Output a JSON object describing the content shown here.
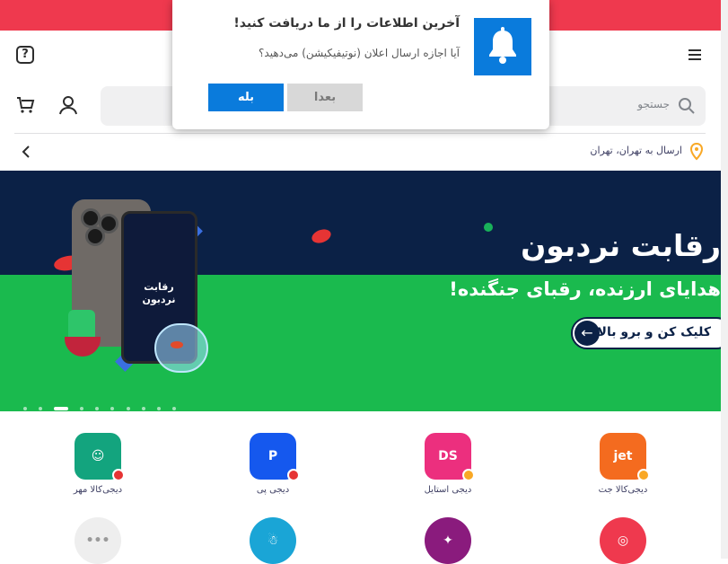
{
  "notification": {
    "title": "آخرین اطلاعات را از ما دریافت کنید!",
    "body": "آیا اجازه ارسال اعلان (نوتیفیکیشن) می‌دهید؟",
    "yes_label": "بله",
    "later_label": "بعدا",
    "icon": "bell-icon"
  },
  "header": {
    "help_icon": "question-icon",
    "menu_icon": "hamburger-icon",
    "cart_icon": "cart-icon",
    "user_icon": "user-icon"
  },
  "search": {
    "placeholder": "جستجو"
  },
  "location": {
    "text": "ارسال به تهران، تهران"
  },
  "banner": {
    "title": "رقابت نردبون",
    "subtitle": "هدایای ارزنده، رقبای جنگنده!",
    "cta": "کلیک کن و برو بالا",
    "phone_label": "رقابت نردبون",
    "slide_count": 10,
    "active_slide": 3
  },
  "apps": [
    {
      "label": "دیجی‌کالا جت",
      "glyph": "jet",
      "color": "#f46b1f"
    },
    {
      "label": "دیجی استایل",
      "glyph": "DS",
      "color": "#ec2f7e"
    },
    {
      "label": "دیجی پی",
      "glyph": "P",
      "color": "#1558ee"
    },
    {
      "label": "دیجی‌کالا مهر",
      "glyph": "☺",
      "color": "#13a47e"
    },
    {
      "label": "",
      "glyph": "◎",
      "color": "#ef394e"
    },
    {
      "label": "",
      "glyph": "✦",
      "color": "#8a1b7d"
    },
    {
      "label": "",
      "glyph": "☃",
      "color": "#1aa5d6"
    },
    {
      "label": "",
      "glyph": "•••",
      "color": "#eeeeee"
    }
  ],
  "colors": {
    "brand_red": "#ef394e",
    "banner_navy": "#0b2146",
    "banner_green": "#1aba4e",
    "primary_blue": "#0a7bdc"
  }
}
